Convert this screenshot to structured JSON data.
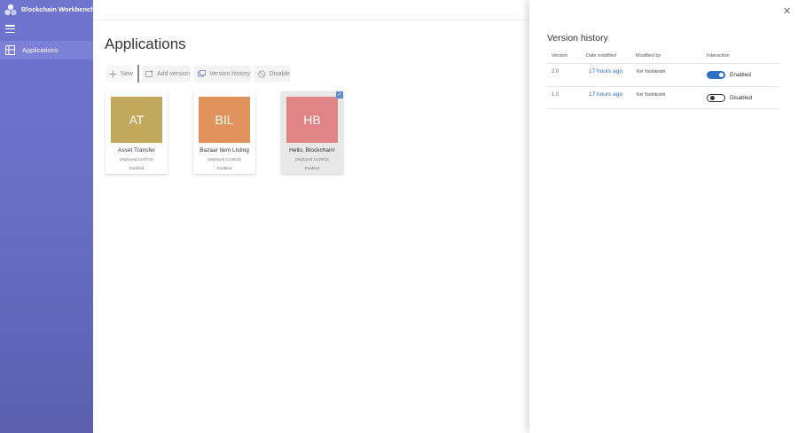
{
  "app": {
    "title": "Blockchain Workbench"
  },
  "sidebar": {
    "items": [
      {
        "label": "Applications",
        "icon": "applications-icon"
      }
    ]
  },
  "main": {
    "title": "Applications",
    "toolbar": {
      "new_label": "New",
      "add_version_label": "Add version",
      "version_history_label": "Version history",
      "disable_label": "Disable"
    },
    "cards": [
      {
        "initials": "AT",
        "name": "Asset Transfer",
        "deployed": "Deployed 11/07/18",
        "status": "Enabled",
        "color": "#c2a85c"
      },
      {
        "initials": "BIL",
        "name": "Bazaar Item Listing",
        "deployed": "Deployed 11/28/18",
        "status": "Enabled",
        "color": "#e0935c"
      },
      {
        "initials": "HB",
        "name": "Hello, Blockchain!",
        "deployed": "Deployed 11/28/18",
        "status": "Enabled",
        "color": "#e08486",
        "selected": true
      }
    ]
  },
  "panel": {
    "title": "Version history",
    "columns": {
      "version": "Version",
      "date": "Date modified",
      "by": "Modified by",
      "interaction": "Interaction"
    },
    "rows": [
      {
        "version": "2.0",
        "date": "17 hours ago",
        "by": "Kei Yoshikoshi",
        "interaction": "Enabled",
        "enabled": true
      },
      {
        "version": "1.0",
        "date": "17 hours ago",
        "by": "Kei Yoshikoshi",
        "interaction": "Disabled",
        "enabled": false
      }
    ]
  },
  "colors": {
    "sidebar": "#6a6fc6",
    "accent": "#2f6fc4"
  }
}
